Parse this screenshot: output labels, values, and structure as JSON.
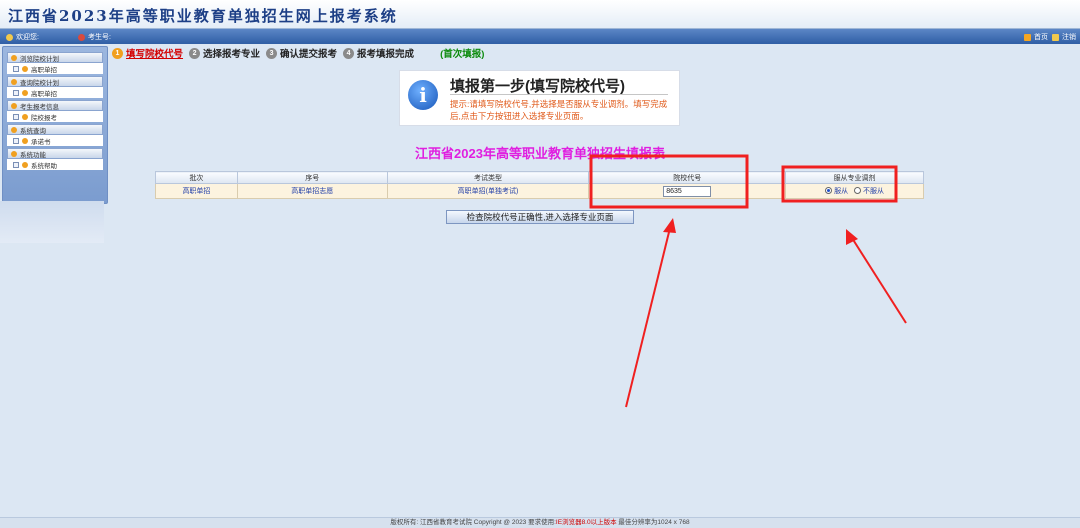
{
  "header": {
    "title": "江西省2023年高等职业教育单独招生网上报考系统"
  },
  "topbar": {
    "welcome": "欢迎您:",
    "examinee": "考生号:",
    "home": "首页",
    "logout": "注销"
  },
  "sidebar": {
    "groups": [
      {
        "head": "浏览院校计划",
        "item": "高职单招"
      },
      {
        "head": "查询院校计划",
        "item": "高职单招"
      },
      {
        "head": "考生报考信息",
        "item": "院校报考"
      },
      {
        "head": "系统查询",
        "item": "承诺书"
      },
      {
        "head": "系统功能",
        "item": "系统帮助"
      }
    ]
  },
  "steps": [
    {
      "num": "1",
      "label": "填写院校代号",
      "active": true
    },
    {
      "num": "2",
      "label": "选择报考专业",
      "active": false
    },
    {
      "num": "3",
      "label": "确认提交报考",
      "active": false
    },
    {
      "num": "4",
      "label": "报考填报完成",
      "active": false
    }
  ],
  "first_fill": "(首次填报)",
  "info": {
    "icon": "i",
    "title": "填报第一步(填写院校代号)",
    "tip": "提示:请填写院校代号,并选择是否服从专业调剂。填写完成后,点击下方按钮进入选择专业页面。"
  },
  "form_title": "江西省2023年高等职业教育单独招生填报表",
  "table": {
    "headers": [
      "批次",
      "序号",
      "考试类型",
      "院校代号",
      "服从专业调剂"
    ],
    "row": {
      "batch": "高职单招",
      "seq": "高职单招志愿",
      "exam_type": "高职单招(单独考试)",
      "school_code": "8635",
      "adjust_yes": "服从",
      "adjust_no": "不服从"
    }
  },
  "submit_label": "检查院校代号正确性,进入选择专业页面",
  "footer": {
    "left": "版权所有: 江西省教育考试院 Copyright @ 2023 要求使用:",
    "warn": "IE浏览器8.0以上版本",
    "right": " 最佳分辨率为1024 x 768"
  },
  "colors": {
    "annotation": "#f02020",
    "accent": "#e01fe0",
    "tip": "#e05a1a"
  }
}
